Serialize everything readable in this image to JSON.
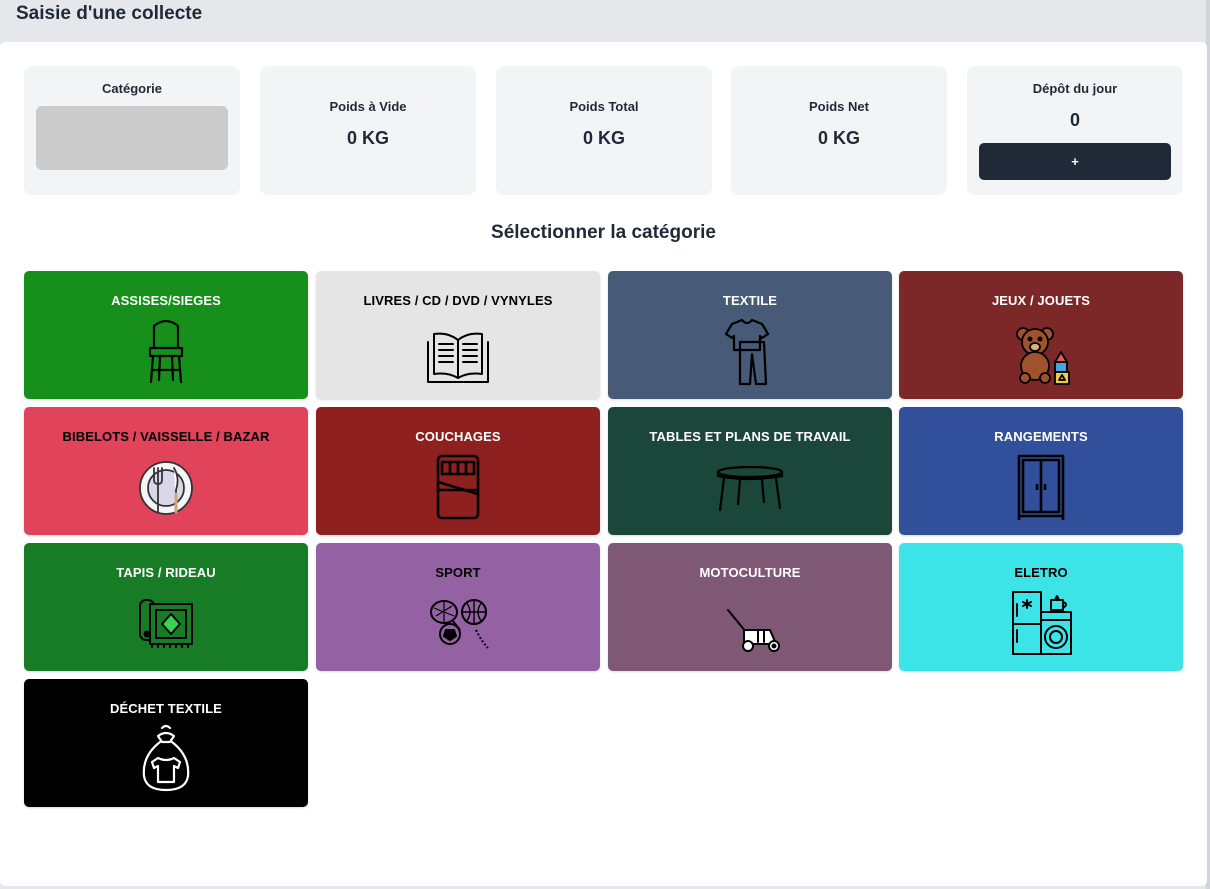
{
  "header": {
    "title": "Saisie d'une collecte"
  },
  "stats": {
    "category": {
      "label": "Catégorie"
    },
    "empty_weight": {
      "label": "Poids à Vide",
      "value": "0 KG"
    },
    "total_weight": {
      "label": "Poids Total",
      "value": "0 KG"
    },
    "net_weight": {
      "label": "Poids Net",
      "value": "0 KG"
    },
    "daily_deposit": {
      "label": "Dépôt du jour",
      "value": "0",
      "add_label": "+"
    }
  },
  "section": {
    "title": "Sélectionner la catégorie"
  },
  "categories": [
    {
      "label": "ASSISES/SIEGES",
      "color": "#16901a",
      "text_color": "#ffffff",
      "icon": "chair-icon"
    },
    {
      "label": "LIVRES / CD / DVD / VYNYLES",
      "color": "#e5e5e5",
      "text_color": "#000000",
      "icon": "open-book-icon"
    },
    {
      "label": "TEXTILE",
      "color": "#475a77",
      "text_color": "#ffffff",
      "icon": "clothes-icon"
    },
    {
      "label": "JEUX / JOUETS",
      "color": "#7d2828",
      "text_color": "#ffffff",
      "icon": "teddy-bear-icon"
    },
    {
      "label": "BIBELOTS / VAISSELLE / BAZAR",
      "color": "#e0435a",
      "text_color": "#000000",
      "icon": "plate-cutlery-icon"
    },
    {
      "label": "COUCHAGES",
      "color": "#8f2020",
      "text_color": "#ffffff",
      "icon": "bed-icon"
    },
    {
      "label": "TABLES ET PLANS DE TRAVAIL",
      "color": "#1b473b",
      "text_color": "#ffffff",
      "icon": "table-icon"
    },
    {
      "label": "RANGEMENTS",
      "color": "#314f9a",
      "text_color": "#ffffff",
      "icon": "wardrobe-icon"
    },
    {
      "label": "TAPIS / RIDEAU",
      "color": "#187c27",
      "text_color": "#ffffff",
      "icon": "rug-icon"
    },
    {
      "label": "SPORT",
      "color": "#9462a3",
      "text_color": "#000000",
      "icon": "sports-balls-icon"
    },
    {
      "label": "MOTOCULTURE",
      "color": "#7e5874",
      "text_color": "#ffffff",
      "icon": "lawn-mower-icon"
    },
    {
      "label": "ELETRO",
      "color": "#3ce4e7",
      "text_color": "#000000",
      "icon": "appliances-icon"
    },
    {
      "label": "DÉCHET TEXTILE",
      "color": "#000000",
      "text_color": "#ffffff",
      "icon": "clothes-bag-icon"
    }
  ]
}
